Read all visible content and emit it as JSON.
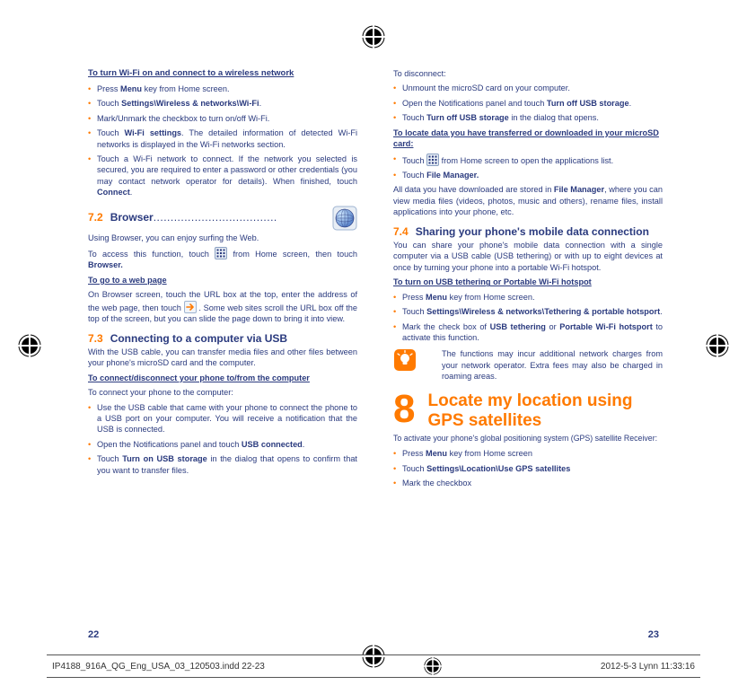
{
  "left": {
    "h1": "To turn Wi-Fi on and connect to a wireless network",
    "wifi": [
      "Press <b>Menu</b> key from Home screen.",
      "Touch <b>Settings\\Wireless & networks\\Wi-Fi</b>.",
      "Mark/Unmark the checkbox to turn on/off Wi-Fi.",
      "Touch <b>Wi-Fi settings</b>. The detailed information of detected Wi-Fi networks is displayed in the Wi-Fi networks section.",
      "Touch a Wi-Fi network to connect. If the network you selected is secured, you are required to enter a password or other credentials (you may contact network operator for details). When finished, touch <b>Connect</b>."
    ],
    "s72_num": "7.2",
    "s72_title": "Browser",
    "browser_p1": "Using Browser, you can enjoy surfing the Web.",
    "browser_p2_a": "To access this function, touch ",
    "browser_p2_b": " from Home screen, then touch <b>Browser.</b>",
    "h2": "To go to a web page",
    "goto_p_a": "On Browser screen, touch the URL box at the top, enter the address of the web page, then touch ",
    "goto_p_b": ". Some web sites scroll the URL box off the top of the screen, but you can slide the page down to bring it into view.",
    "s73_num": "7.3",
    "s73_title": "Connecting to a computer via USB",
    "usb_p1": "With the USB cable, you can transfer media files and other files between your phone's microSD card and the computer.",
    "h3": "To connect/disconnect your phone to/from the computer",
    "conn_intro": "To connect your phone to the computer:",
    "conn": [
      "Use the USB cable that came with your phone to connect the phone to a USB port on your computer. You will receive a notification that the USB is connected.",
      "Open the Notifications panel and touch <b>USB connected</b>.",
      "Touch <b>Turn on USB storage</b> in the dialog that opens to confirm that you want to transfer files."
    ],
    "page": "22"
  },
  "right": {
    "disc_intro": "To disconnect:",
    "disc": [
      "Unmount the microSD card on your computer.",
      "Open the Notifications panel and touch <b>Turn off USB storage</b>.",
      "Touch <b>Turn off USB storage</b> in the dialog that opens."
    ],
    "h1": "To locate data you have transferred or downloaded in your microSD card:",
    "locate": [
      "Touch __APPS__ from Home screen to open the applications list.",
      "Touch <b>File Manager.</b>"
    ],
    "locate_p": "All data you have downloaded are stored in <b>File Manager</b>, where you can view media files (videos, photos, music and others), rename files, install applications into your phone, etc.",
    "s74_num": "7.4",
    "s74_title": "Sharing your phone's mobile data connection",
    "share_p": "You can share your phone's mobile data connection with a single computer via a USB cable (USB tethering) or with up to eight devices at once by turning your phone into a portable Wi-Fi hotspot.",
    "h2": "To turn on USB tethering or Portable Wi-Fi hotspot",
    "tether": [
      "Press <b>Menu</b> key from Home screen.",
      "Touch <b>Settings\\Wireless & networks\\Tethering & portable hotsport</b>.",
      "Mark the check box of <b>USB tethering</b> or <b>Portable Wi-Fi hotsport</b> to activate this function."
    ],
    "note": "The functions may incur additional network charges from your network operator. Extra fees may also be charged in roaming areas.",
    "big8": "8",
    "big8_title": "Locate my location using GPS satellites",
    "gps_intro": "To activate your phone's global positioning system (GPS) satellite Receiver:",
    "gps": [
      "Press <b>Menu</b> key from Home screen",
      "Touch <b>Settings\\Location\\Use GPS satellites</b>",
      "Mark the checkbox"
    ],
    "page": "23"
  },
  "footer": {
    "file": "IP4188_916A_QG_Eng_USA_03_120503.indd   22-23",
    "ts": "2012-5-3   Lynn 11:33:16"
  }
}
